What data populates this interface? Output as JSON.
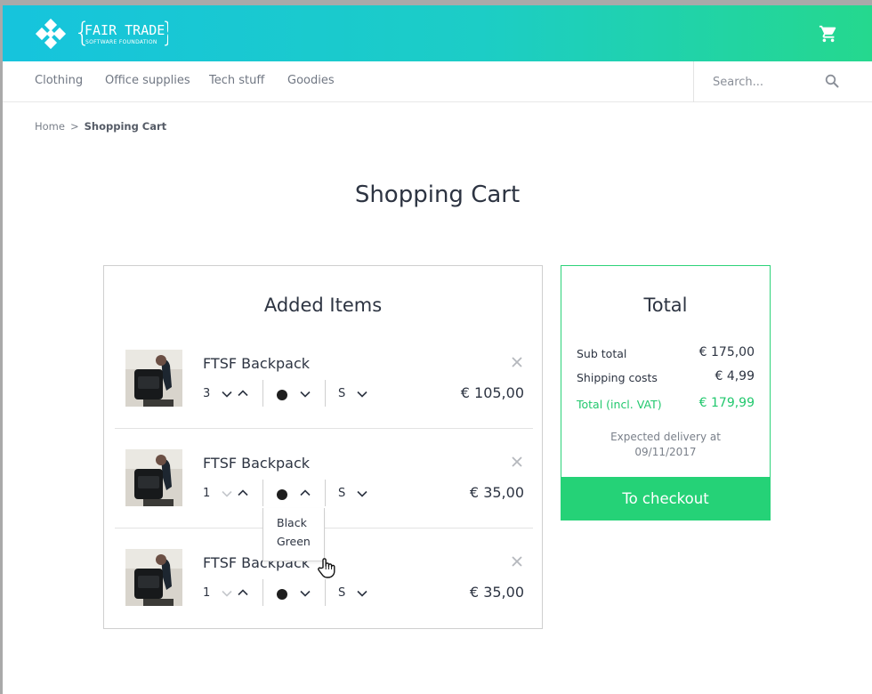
{
  "header": {
    "logo_main": "FAIR TRADE",
    "logo_sub": "SOFTWARE FOUNDATION",
    "logo_icon": "fair-trade-diamond-logo",
    "cart_icon": "shopping-cart-icon"
  },
  "nav": {
    "items": [
      {
        "label": "Clothing"
      },
      {
        "label": "Office supplies"
      },
      {
        "label": "Tech stuff"
      },
      {
        "label": "Goodies"
      }
    ],
    "search": {
      "placeholder": "Search...",
      "icon": "search-icon"
    }
  },
  "breadcrumb": {
    "home": "Home",
    "separator": ">",
    "current": "Shopping Cart"
  },
  "page_title": "Shopping Cart",
  "items_section": {
    "title": "Added Items",
    "items": [
      {
        "name": "FTSF Backpack",
        "quantity": "3",
        "color": "#1e1e1e",
        "size": "S",
        "price": "€ 105,00"
      },
      {
        "name": "FTSF Backpack",
        "quantity": "1",
        "color": "#1e1e1e",
        "size": "S",
        "price": "€ 35,00"
      },
      {
        "name": "FTSF Backpack",
        "quantity": "1",
        "color": "#1e1e1e",
        "size": "S",
        "price": "€ 35,00"
      }
    ],
    "color_dropdown": {
      "options": [
        "Black",
        "Green"
      ]
    }
  },
  "total": {
    "title": "Total",
    "subtotal_label": "Sub total",
    "subtotal_value": "€ 175,00",
    "shipping_label": "Shipping costs",
    "shipping_value": "€ 4,99",
    "total_label": "Total (incl. VAT)",
    "total_value": "€ 179,99",
    "delivery_label": "Expected delivery at",
    "delivery_date": "09/11/2017",
    "checkout_label": "To checkout"
  },
  "colors": {
    "brand_cyan": "#16c4dd",
    "brand_green": "#25d277",
    "text_dark": "#2d3442"
  }
}
